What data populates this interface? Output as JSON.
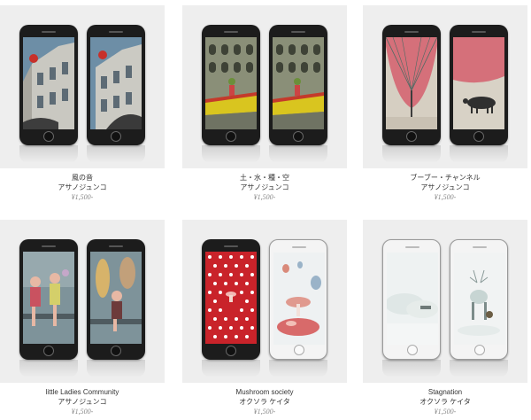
{
  "products": [
    {
      "title": "風の音",
      "artist": "アサノジュンコ",
      "price": "¥1,500-"
    },
    {
      "title": "土・水・種・空",
      "artist": "アサノジュンコ",
      "price": "¥1,500-"
    },
    {
      "title": "ブーブー・チャンネル",
      "artist": "アサノジュンコ",
      "price": "¥1,500-"
    },
    {
      "title": "little Ladies Community",
      "artist": "アサノジュンコ",
      "price": "¥1,500-"
    },
    {
      "title": "Mushroom society",
      "artist": "オクソラ ケイタ",
      "price": "¥1,500-"
    },
    {
      "title": "Stagnation",
      "artist": "オクソラ ケイタ",
      "price": "¥1,500-"
    }
  ],
  "colors": {
    "tile_background": "#eeeeee",
    "text": "#333333",
    "price": "#888888"
  }
}
